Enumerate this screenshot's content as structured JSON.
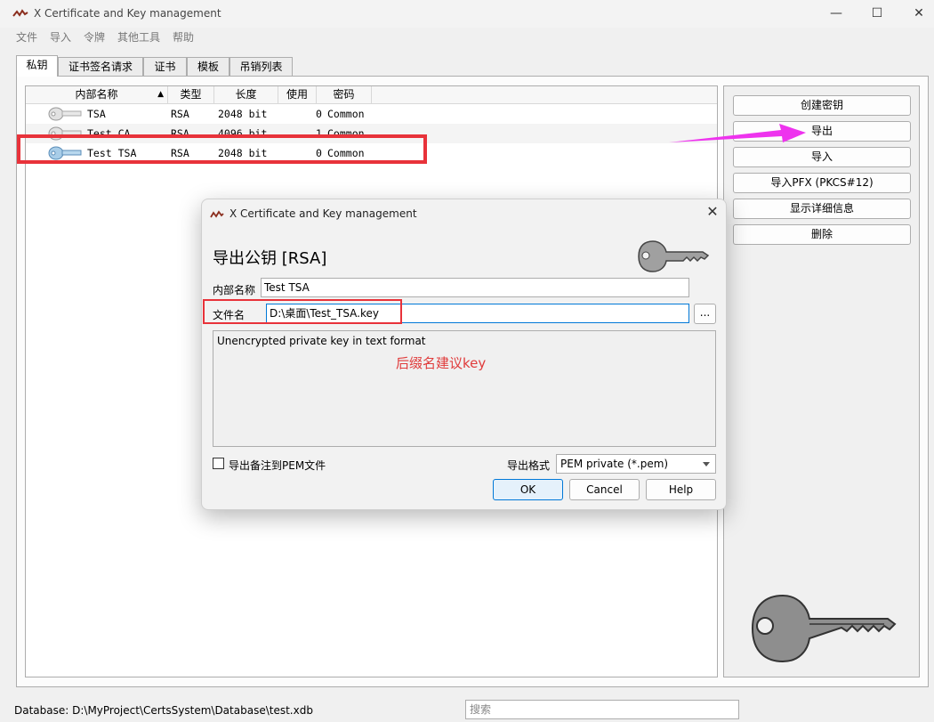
{
  "window": {
    "title": "X Certificate and Key management",
    "controls": {
      "minimize": "—",
      "maximize": "☐",
      "close": "✕"
    }
  },
  "menu": [
    "文件",
    "导入",
    "令牌",
    "其他工具",
    "帮助"
  ],
  "tabs": [
    "私钥",
    "证书签名请求",
    "证书",
    "模板",
    "吊销列表"
  ],
  "keylist": {
    "columns": [
      "内部名称",
      "类型",
      "长度",
      "使用",
      "密码"
    ],
    "rows": [
      {
        "name": "TSA",
        "type": "RSA",
        "length": "2048 bit",
        "use": "0",
        "password": "Common"
      },
      {
        "name": "Test CA",
        "type": "RSA",
        "length": "4096 bit",
        "use": "1",
        "password": "Common"
      },
      {
        "name": "Test TSA",
        "type": "RSA",
        "length": "2048 bit",
        "use": "0",
        "password": "Common"
      }
    ]
  },
  "side_buttons": [
    "创建密钥",
    "导出",
    "导入",
    "导入PFX (PKCS#12)",
    "显示详细信息",
    "删除"
  ],
  "dialog": {
    "title": "X Certificate and Key management",
    "close": "✕",
    "heading": "导出公钥 [RSA]",
    "name_label": "内部名称",
    "name_value": "Test TSA",
    "file_label": "文件名",
    "file_value": "D:\\桌面\\Test_TSA.key",
    "browse": "...",
    "description": "Unencrypted private key in text format",
    "annotation": "后缀名建议key",
    "pem_comment_label": "导出备注到PEM文件",
    "format_label": "导出格式",
    "format_value": "PEM private (*.pem)",
    "ok": "OK",
    "cancel": "Cancel",
    "help": "Help"
  },
  "status": {
    "database": "Database: D:\\MyProject\\CertsSystem\\Database\\test.xdb",
    "search_placeholder": "搜索"
  },
  "colors": {
    "accent": "#0078d7",
    "highlight": "#e8323a",
    "arrow": "#ee33ee",
    "annotation": "#e03b3b"
  }
}
